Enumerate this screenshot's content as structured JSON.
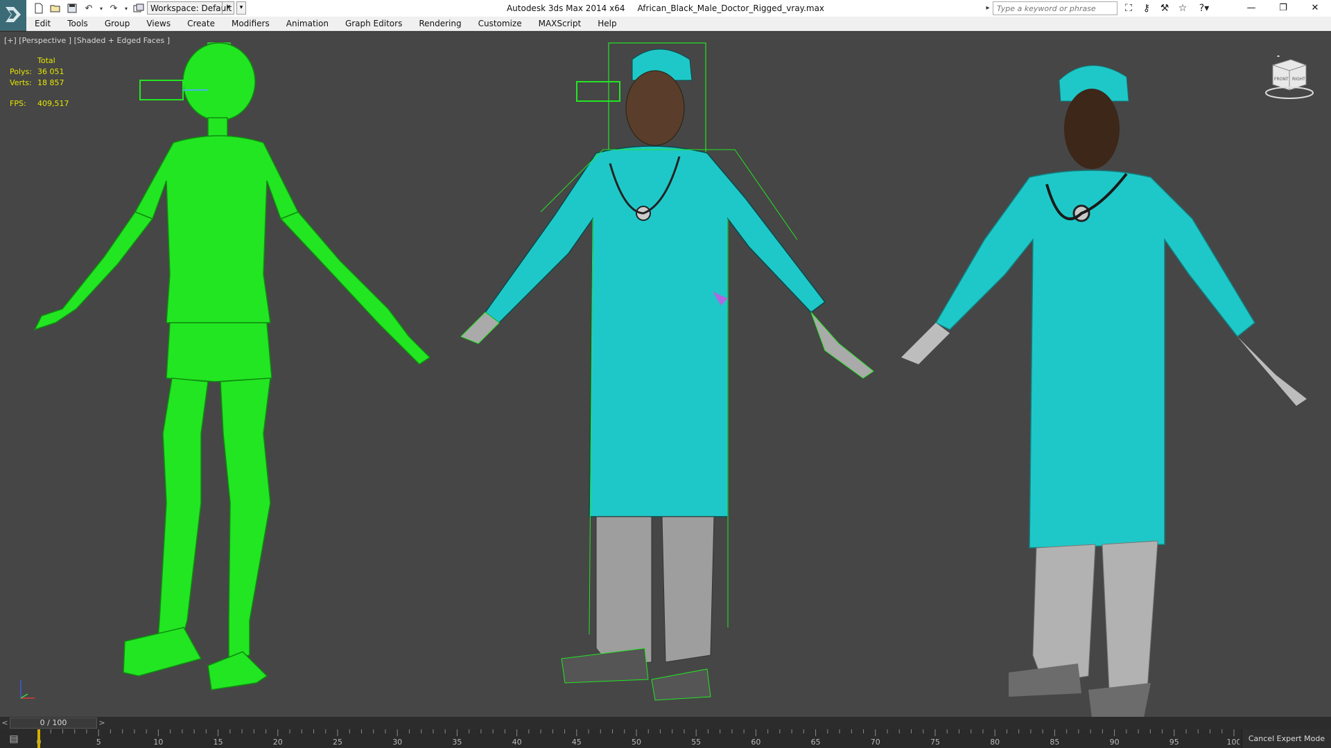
{
  "titlebar": {
    "workspace": "Workspace: Default",
    "app_name": "Autodesk 3ds Max  2014 x64",
    "file_name": "African_Black_Male_Doctor_Rigged_vray.max",
    "search_placeholder": "Type a keyword or phrase",
    "quick_access_icons": [
      "new-icon",
      "open-icon",
      "save-icon",
      "undo-icon",
      "undo-dropdown-icon",
      "redo-icon",
      "redo-dropdown-icon",
      "project-folder-icon"
    ],
    "search_icons": [
      "binoculars-icon",
      "key-icon",
      "search-subscription-icon",
      "star-icon",
      "help-icon"
    ],
    "window_buttons": [
      "minimize-icon",
      "restore-icon",
      "close-icon"
    ]
  },
  "menu": {
    "items": [
      "Edit",
      "Tools",
      "Group",
      "Views",
      "Create",
      "Modifiers",
      "Animation",
      "Graph Editors",
      "Rendering",
      "Customize",
      "MAXScript",
      "Help"
    ]
  },
  "viewport": {
    "label": "[+] [Perspective ] [Shaded + Edged Faces ]",
    "stats": {
      "total_label": "Total",
      "polys_label": "Polys:",
      "polys_value": "36 051",
      "verts_label": "Verts:",
      "verts_value": "18 857",
      "fps_label": "FPS:",
      "fps_value": "409,517"
    },
    "viewcube": {
      "front_label": "FRONT",
      "right_label": "RIGHT"
    },
    "colors": {
      "background": "#464646",
      "biped": "#22e622",
      "scrubs": "#1fc8c8",
      "pants": "#9e9e9e",
      "stats": "#e6e600"
    }
  },
  "timeline": {
    "frame_display": "0 / 100",
    "ruler_ticks": [
      "0",
      "5",
      "10",
      "15",
      "20",
      "25",
      "30",
      "35",
      "40",
      "45",
      "50",
      "55",
      "60",
      "65",
      "70",
      "75",
      "80",
      "85",
      "90",
      "95",
      "100"
    ]
  },
  "status": {
    "cancel_expert_mode": "Cancel Expert Mode"
  }
}
